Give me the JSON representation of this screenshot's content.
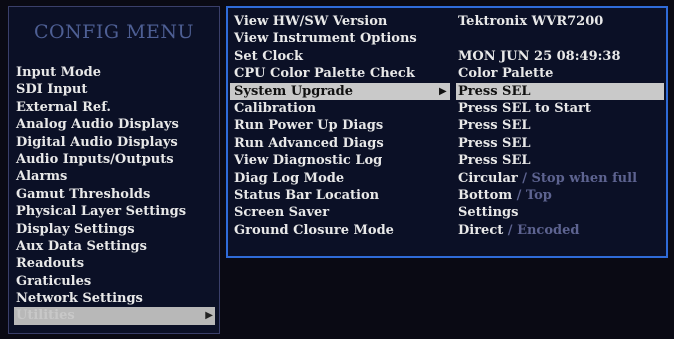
{
  "config_menu": {
    "title": "CONFIG MENU",
    "items": [
      "Input Mode",
      "SDI Input",
      "External Ref.",
      "Analog Audio Displays",
      "Digital Audio Displays",
      "Audio Inputs/Outputs",
      "Alarms",
      "Gamut Thresholds",
      "Physical Layer Settings",
      "Display Settings",
      "Aux Data Settings",
      "Readouts",
      "Graticules",
      "Network Settings",
      "Utilities"
    ],
    "selected_index": 14
  },
  "utilities": {
    "selected_index": 4,
    "rows": [
      {
        "label": "View HW/SW Version",
        "value": "Tektronix WVR7200",
        "alt": ""
      },
      {
        "label": "View Instrument Options",
        "value": "",
        "alt": ""
      },
      {
        "label": "Set Clock",
        "value": "MON JUN 25 08:49:38",
        "alt": ""
      },
      {
        "label": "CPU Color Palette Check",
        "value": "Color Palette",
        "alt": ""
      },
      {
        "label": "System Upgrade",
        "value": "Press SEL",
        "alt": ""
      },
      {
        "label": "Calibration",
        "value": "Press SEL to Start",
        "alt": ""
      },
      {
        "label": "Run Power Up Diags",
        "value": "Press SEL",
        "alt": ""
      },
      {
        "label": "Run Advanced Diags",
        "value": "Press SEL",
        "alt": ""
      },
      {
        "label": "View Diagnostic Log",
        "value": "Press SEL",
        "alt": ""
      },
      {
        "label": "Diag Log Mode",
        "value": "Circular",
        "alt": " / Stop when full"
      },
      {
        "label": "Status Bar Location",
        "value": "Bottom",
        "alt": " / Top"
      },
      {
        "label": "Screen Saver",
        "value": "Settings",
        "alt": ""
      },
      {
        "label": "Ground Closure Mode",
        "value": "Direct",
        "alt": " / Encoded"
      }
    ]
  }
}
